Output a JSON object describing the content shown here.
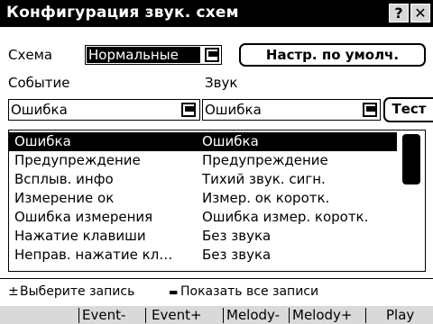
{
  "window": {
    "title": "Конфигурация звук. схем",
    "help_label": "?",
    "close_label": "✕"
  },
  "scheme": {
    "label": "Схема",
    "value": "Нормальные",
    "reset_label": "Настр. по умолч."
  },
  "event": {
    "label": "Событие",
    "value": "Ошибка"
  },
  "sound": {
    "label": "Звук",
    "value": "Ошибка",
    "test_label": "Тест"
  },
  "list": {
    "rows": [
      {
        "event": "Ошибка",
        "sound": "Ошибка"
      },
      {
        "event": "Предупреждение",
        "sound": "Предупреждение"
      },
      {
        "event": "Всплыв. инфо",
        "sound": "Тихий звук. сигн."
      },
      {
        "event": "Измерение ок",
        "sound": "Измер. ок коротк."
      },
      {
        "event": "Ошибка измерения",
        "sound": "Ошибка измер. коротк."
      },
      {
        "event": "Нажатие клавиши",
        "sound": "Без звука"
      },
      {
        "event": "Неправ. нажатие кл…",
        "sound": "Без звука"
      }
    ]
  },
  "hints": {
    "select_icon": "±",
    "select_text": "Выберите запись",
    "show_icon": "▬",
    "show_text": "Показать все записи"
  },
  "softkeys": {
    "k1": "Event-",
    "k2": "Event+",
    "k3": "Melody-",
    "k4": "Melody+",
    "k5": "Play"
  },
  "colors": {
    "background": "#ffffff",
    "selection": "#000000",
    "softkey_bar": "#d9d9d9"
  }
}
